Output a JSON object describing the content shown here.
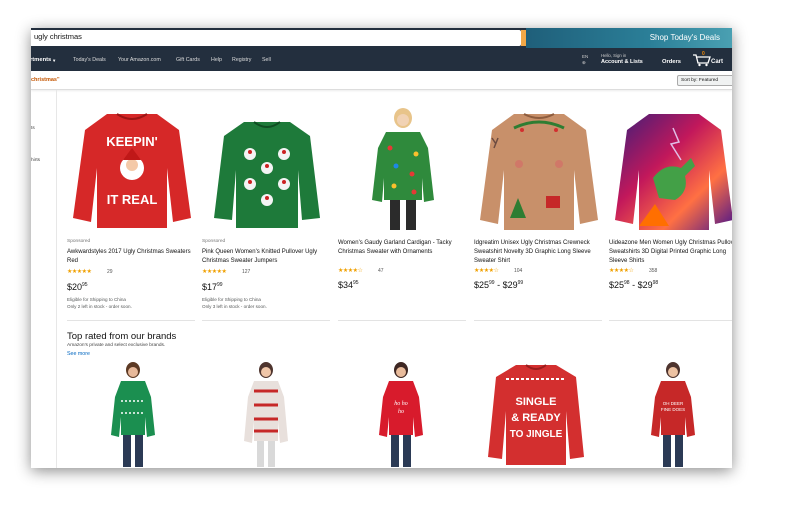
{
  "search": {
    "query": "ugly christmas"
  },
  "promo": {
    "label": "Shop Today's Deals"
  },
  "nav": {
    "departments": "rtments",
    "links": [
      "Today's Deals",
      "Your Amazon.com",
      "Gift Cards",
      "Help",
      "Registry",
      "Sell"
    ],
    "language": "EN",
    "hello": "Hello, Sign in",
    "account": "Account & Lists",
    "orders": "Orders",
    "cart_count": "0",
    "cart": "Cart"
  },
  "results": {
    "term": "christmas\"",
    "sort": "Sort by: Featured"
  },
  "sidebar": {
    "items": [
      "ts",
      "hirts"
    ]
  },
  "products": [
    {
      "sponsored": "Sponsored",
      "title": "Awkwardstyles 2017 Ugly Christmas Sweaters Red",
      "rating": 4.5,
      "stars": "★★★★★",
      "reviews": "29",
      "price_whole": "$20",
      "price_cents": "95",
      "shipping": "Eligible for Shipping to China",
      "stock": "Only 2 left in stock - order soon."
    },
    {
      "sponsored": "Sponsored",
      "title": "Pink Queen Women's Knitted Pullover Ugly Christmas Sweater Jumpers",
      "rating": 4.5,
      "stars": "★★★★★",
      "reviews": "127",
      "price_whole": "$17",
      "price_cents": "99",
      "shipping": "Eligible for Shipping to China",
      "stock": "Only 3 left in stock - order soon."
    },
    {
      "title": "Women's Gaudy Garland Cardigan - Tacky Christmas Sweater with Ornaments",
      "rating": 4.0,
      "stars": "★★★★☆",
      "reviews": "47",
      "price_whole": "$34",
      "price_cents": "95"
    },
    {
      "title": "Idgreatim Unisex Ugly Christmas Crewneck Sweatshirt Novelty 3D Graphic Long Sleeve Sweater Shirt",
      "rating": 4.0,
      "stars": "★★★★☆",
      "reviews": "104",
      "price_whole": "$25",
      "price_cents": "99",
      "price_sep": " - ",
      "price2_whole": "$29",
      "price2_cents": "99"
    },
    {
      "title": "Uideazone Men Women Ugly Christmas Pullover Sweatshirts 3D Digital Printed Graphic Long Sleeve Shirts",
      "rating": 4.0,
      "stars": "★★★★☆",
      "reviews": "358",
      "price_whole": "$25",
      "price_cents": "98",
      "price_sep": " - ",
      "price2_whole": "$29",
      "price2_cents": "98"
    }
  ],
  "brands": {
    "title": "Top rated from our brands",
    "subtitle": "Amazon's private and select exclusive brands.",
    "more": "See more"
  },
  "colors": {
    "nav_bg": "#232f3e",
    "search_button": "#f3a847",
    "link": "#0066c0",
    "star": "#f0a000",
    "promo": "#2b7f98"
  },
  "icons": [
    "search-icon",
    "cart-icon",
    "chevron-down-icon",
    "globe-icon"
  ]
}
